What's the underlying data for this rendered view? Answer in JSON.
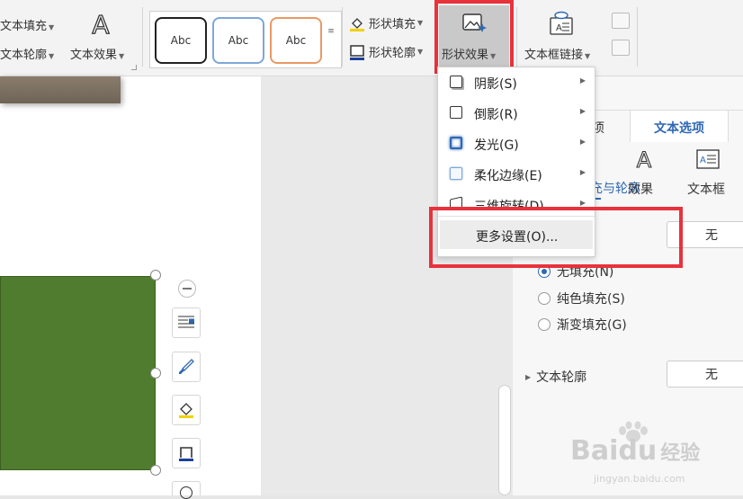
{
  "ribbon": {
    "text_fill": "文本填充",
    "text_outline": "文本轮廓",
    "text_effect": "文本效果",
    "style_samples": [
      "Abc",
      "Abc",
      "Abc"
    ],
    "shape_fill": "形状填充",
    "shape_outline": "形状轮廓",
    "shape_effect": "形状效果",
    "textbox_link": "文本框链接"
  },
  "shape_effect_menu": {
    "items": [
      {
        "label": "阴影(S)",
        "icon": "shadow-icon"
      },
      {
        "label": "倒影(R)",
        "icon": "reflection-icon"
      },
      {
        "label": "发光(G)",
        "icon": "glow-icon"
      },
      {
        "label": "柔化边缘(E)",
        "icon": "soft-edge-icon"
      },
      {
        "label": "三维旋转(D)",
        "icon": "rotation-3d-icon"
      }
    ],
    "more_settings": "更多设置(O)..."
  },
  "pane": {
    "tab_partial": "项",
    "tab_text_options": "文本选项",
    "subtab_partial": "充与轮廓",
    "subtab_effect": "效果",
    "subtab_textbox": "文本框",
    "fill_value": "无",
    "fill_options": [
      "无填充(N)",
      "纯色填充(S)",
      "渐变填充(G)"
    ],
    "text_outline_label": "文本轮廓",
    "text_outline_value": "无"
  },
  "colors": {
    "shape_fill": "#4f7c2e",
    "highlight": "#e8323c",
    "accent": "#2f68b4"
  },
  "watermark": {
    "brand": "Baidu",
    "brand_cn": "经验",
    "url": "jingyan.baidu.com"
  }
}
